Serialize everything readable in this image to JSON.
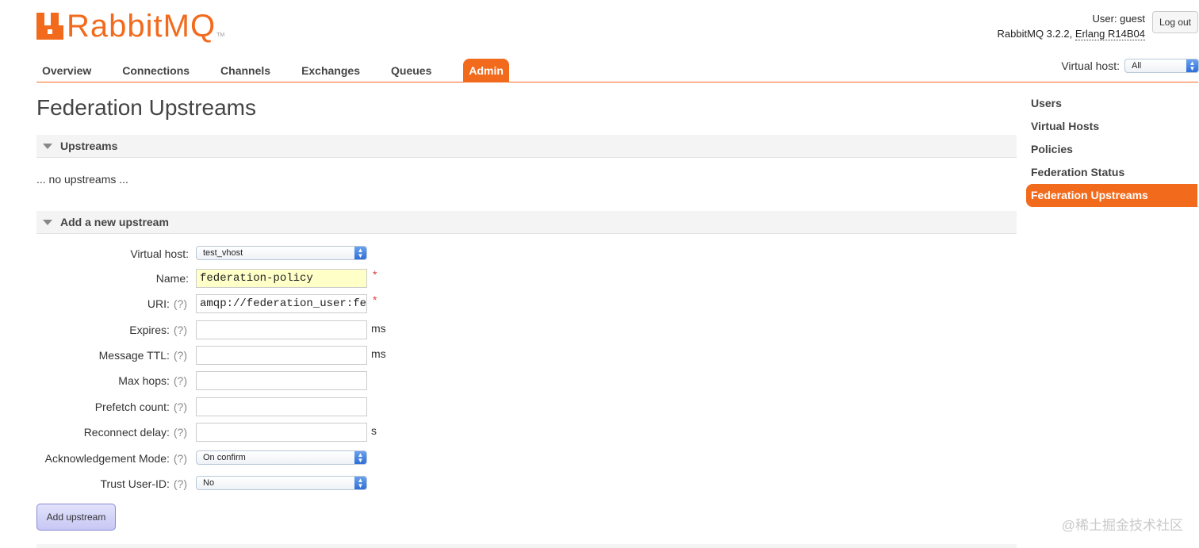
{
  "brand": {
    "name": "RabbitMQ",
    "tm": "TM",
    "color": "#f26b1d"
  },
  "header": {
    "user_line": "User: guest",
    "version_prefix": "RabbitMQ 3.2.2, ",
    "erlang": "Erlang R14B04",
    "logout_label": "Log out"
  },
  "nav": {
    "tabs": [
      {
        "label": "Overview"
      },
      {
        "label": "Connections"
      },
      {
        "label": "Channels"
      },
      {
        "label": "Exchanges"
      },
      {
        "label": "Queues"
      },
      {
        "label": "Admin",
        "active": true
      }
    ],
    "vhost_label": "Virtual host:",
    "vhost_value": "All"
  },
  "page": {
    "title": "Federation Upstreams",
    "upstreams_section": "Upstreams",
    "no_upstreams": "... no upstreams ...",
    "add_section": "Add a new upstream"
  },
  "form": {
    "help": "(?)",
    "required_mark": "*",
    "vhost": {
      "label": "Virtual host:",
      "value": "test_vhost"
    },
    "name": {
      "label": "Name:",
      "value": "federation-policy"
    },
    "uri": {
      "label": "URI:",
      "value": "amqp://federation_user:federation_pass@"
    },
    "expires": {
      "label": "Expires:",
      "value": "",
      "unit": "ms"
    },
    "message_ttl": {
      "label": "Message TTL:",
      "value": "",
      "unit": "ms"
    },
    "max_hops": {
      "label": "Max hops:",
      "value": ""
    },
    "prefetch": {
      "label": "Prefetch count:",
      "value": ""
    },
    "reconnect": {
      "label": "Reconnect delay:",
      "value": "",
      "unit": "s"
    },
    "ack_mode": {
      "label": "Acknowledgement Mode:",
      "value": "On confirm"
    },
    "trust_user": {
      "label": "Trust User-ID:",
      "value": "No"
    },
    "submit_label": "Add upstream"
  },
  "sidebar": {
    "items": [
      {
        "label": "Users"
      },
      {
        "label": "Virtual Hosts"
      },
      {
        "label": "Policies"
      },
      {
        "label": "Federation Status"
      },
      {
        "label": "Federation Upstreams",
        "active": true
      }
    ]
  },
  "watermark": "@稀土掘金技术社区"
}
